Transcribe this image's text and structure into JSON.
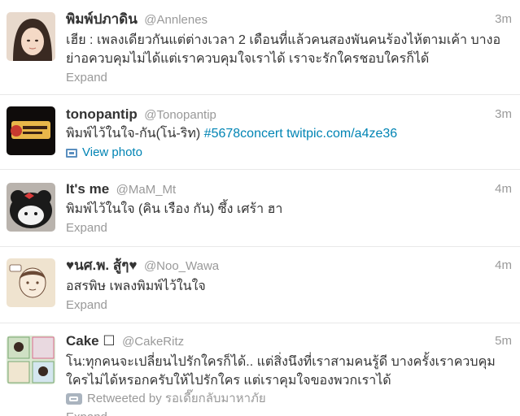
{
  "tweets": [
    {
      "fullname": "พิมพ์ปภาดิน",
      "username": "@Annlenes",
      "time": "3m",
      "text": "เฮีย : เพลงเดียวกันแต่ต่างเวลา 2 เดือนที่แล้วคนสองพันคนร้องไห้ตามเค้า บางอย่าอควบคุมไม่ได้แต่เราควบคุมใจเราได้ เราจะรักใครชอบใครก็ได้",
      "action": "Expand",
      "avatar_colors": [
        "#e8d9cc",
        "#3a2a22"
      ]
    },
    {
      "fullname": "tonopantip",
      "username": "@Tonopantip",
      "time": "3m",
      "text_plain": "พิมพ์ไว้ในใจ-กัน(โน่-ริท) ",
      "hashtag": "#5678concert",
      "link": "twitpic.com/a4ze36",
      "action": "View photo",
      "avatar_colors": [
        "#0f0c0b",
        "#e8b74a",
        "#c63a2f"
      ]
    },
    {
      "fullname": "It's me",
      "username": "@MaM_Mt",
      "time": "4m",
      "text": "พิมพ์ไว้ในใจ (คิน เรือง กัน) ซึ้ง เศร้า ฮา",
      "action": "Expand",
      "avatar_colors": [
        "#1a1a1a",
        "#f3f3f3",
        "#d83a3a"
      ]
    },
    {
      "fullname": "♥นศ.พ. สู้ๆ♥",
      "username": "@Noo_Wawa",
      "time": "4m",
      "text": "อสรพิษ เพลงพิมพ์ไว้ในใจ",
      "action": "Expand",
      "avatar_colors": [
        "#efe3cf",
        "#6b4a36"
      ]
    },
    {
      "fullname": "Cake ☐",
      "username": "@CakeRitz",
      "time": "5m",
      "text": "โน:ทุกคนจะเปลี่ยนไปรักใครก็ได้.. แต่สิ่งนึงที่เราสามคนรู้ดี บางครั้งเราควบคุมใครไม่ได้หรอกครับให้ไปรักใคร แต่เราคุมใจของพวกเราได้",
      "retweeted": "Retweeted by รอเดี๊ยกลับมาหาภัย",
      "action": "Expand",
      "avatar_colors": [
        "#dbe8d2",
        "#7aa872",
        "#d96b8c"
      ]
    }
  ]
}
